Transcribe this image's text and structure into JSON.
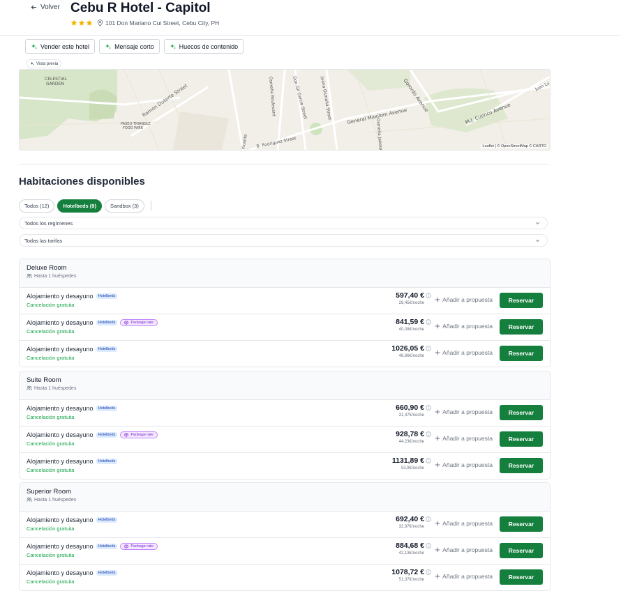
{
  "header": {
    "back_label": "Volver",
    "hotel_name": "Cebu R Hotel - Capitol",
    "stars": 3,
    "address": "101 Don Mariano Cui Street, Cebu City, PH"
  },
  "actions": [
    {
      "label": "Vender este hotel"
    },
    {
      "label": "Mensaje corto"
    },
    {
      "label": "Huecos de contenido"
    }
  ],
  "preview_label": "Vista previa",
  "map": {
    "attribution": "Leaflet | © OpenStreetMap © CARTO",
    "labels": [
      "CELESTIAL GARDEN",
      "Ramon Duterte Street",
      "PASEO TRIANGLE FOOD PARK",
      "Osmeña Boulevard",
      "Don Gil Garcia Street",
      "Juana Osmeña Street",
      "General Maxilom Avenue",
      "Gorordo Avenue",
      "M.J. Cuenco Avenue",
      "Vicente",
      "B. Rodriguez Street",
      "Osmeña Jakosalem",
      "Juan Luna"
    ]
  },
  "rooms_section": {
    "title": "Habitaciones disponibles",
    "filters": [
      {
        "label": "Todos (12)",
        "active": false
      },
      {
        "label": "Hotelbeds (9)",
        "active": true
      },
      {
        "label": "Sandbox (3)",
        "active": false
      }
    ],
    "regime_select": "Todos los regímenes",
    "rate_select": "Todas las tarifas"
  },
  "rooms": [
    {
      "name": "Deluxe Room",
      "guests": "Hasta 1 huéspedes",
      "rates": [
        {
          "board": "Alojamiento y desayuno",
          "provider": "Hotelbeds",
          "package": false,
          "cancellation": "Cancelación gratuita",
          "price": "597,40 €",
          "per_night": "28,45€/noche"
        },
        {
          "board": "Alojamiento y desayuno",
          "provider": "Hotelbeds",
          "package": true,
          "cancellation": "Cancelación gratuita",
          "price": "841,59 €",
          "per_night": "40,08€/noche"
        },
        {
          "board": "Alojamiento y desayuno",
          "provider": "Hotelbeds",
          "package": false,
          "cancellation": "Cancelación gratuita",
          "price": "1026,05 €",
          "per_night": "48,86€/noche"
        }
      ]
    },
    {
      "name": "Suite Room",
      "guests": "Hasta 1 huéspedes",
      "rates": [
        {
          "board": "Alojamiento y desayuno",
          "provider": "Hotelbeds",
          "package": false,
          "cancellation": "Cancelación gratuita",
          "price": "660,90 €",
          "per_night": "31,47€/noche"
        },
        {
          "board": "Alojamiento y desayuno",
          "provider": "Hotelbeds",
          "package": true,
          "cancellation": "Cancelación gratuita",
          "price": "928,78 €",
          "per_night": "44,23€/noche"
        },
        {
          "board": "Alojamiento y desayuno",
          "provider": "Hotelbeds",
          "package": false,
          "cancellation": "Cancelación gratuita",
          "price": "1131,89 €",
          "per_night": "53,9€/noche"
        }
      ]
    },
    {
      "name": "Superior Room",
      "guests": "Hasta 1 huéspedes",
      "rates": [
        {
          "board": "Alojamiento y desayuno",
          "provider": "Hotelbeds",
          "package": false,
          "cancellation": "Cancelación gratuita",
          "price": "692,40 €",
          "per_night": "32,97€/noche"
        },
        {
          "board": "Alojamiento y desayuno",
          "provider": "Hotelbeds",
          "package": true,
          "cancellation": "Cancelación gratuita",
          "price": "884,68 €",
          "per_night": "42,13€/noche"
        },
        {
          "board": "Alojamiento y desayuno",
          "provider": "Hotelbeds",
          "package": false,
          "cancellation": "Cancelación gratuita",
          "price": "1078,72 €",
          "per_night": "51,37€/noche"
        }
      ]
    }
  ],
  "labels": {
    "package_rate": "Package rate",
    "add_to_proposal": "Añadir a propuesta",
    "reserve": "Reservar"
  },
  "colors": {
    "primary_green": "#15803d",
    "cancel_green": "#16a34a",
    "star_gold": "#f5b301",
    "hotelbeds_badge": "#dbeafe",
    "package_badge": "#f3e8ff"
  }
}
